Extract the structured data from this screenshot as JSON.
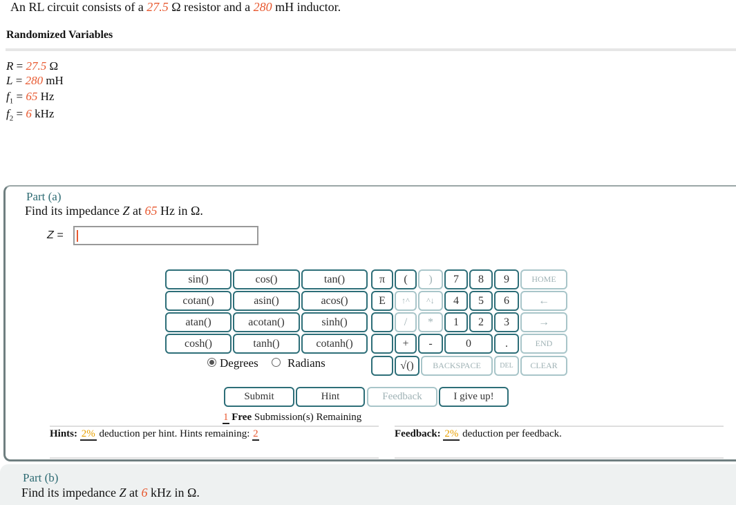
{
  "intro": {
    "prefix": "An RL circuit consists of a ",
    "r_value": "27.5",
    "r_unit": " Ω resistor and a ",
    "l_value": "280",
    "l_unit": " mH inductor."
  },
  "randomized": {
    "title": "Randomized Variables",
    "vars": [
      {
        "sym": "R",
        "sub": "",
        "eq": " = ",
        "value": "27.5",
        "unit": " Ω"
      },
      {
        "sym": "L",
        "sub": "",
        "eq": " = ",
        "value": "280",
        "unit": " mH"
      },
      {
        "sym": "f",
        "sub": "1",
        "eq": " = ",
        "value": "65",
        "unit": " Hz"
      },
      {
        "sym": "f",
        "sub": "2",
        "eq": " = ",
        "value": "6",
        "unit": " kHz"
      }
    ]
  },
  "part_a": {
    "title": "Part (a)",
    "q_prefix": "Find its impedance ",
    "q_var": "Z",
    "q_mid": " at ",
    "q_value": "65",
    "q_suffix": " Hz in Ω.",
    "input_label": "Z = ",
    "input_value": ""
  },
  "keypad": {
    "functions": [
      "sin()",
      "cos()",
      "tan()",
      "cotan()",
      "asin()",
      "acos()",
      "atan()",
      "acotan()",
      "sinh()",
      "cosh()",
      "tanh()",
      "cotanh()"
    ],
    "pi": "π",
    "lparen": "(",
    "rparen": ")",
    "e": "E",
    "up_up": "↑^",
    "up_down": "^↓",
    "div": "/",
    "mul": "*",
    "plus": "+",
    "minus": "-",
    "sqrt": "√()",
    "digits": [
      "7",
      "8",
      "9",
      "4",
      "5",
      "6",
      "1",
      "2",
      "3",
      "0",
      "."
    ],
    "home": "HOME",
    "left": "←",
    "right": "→",
    "end": "END",
    "backspace": "BACKSPACE",
    "del": "DEL",
    "clear": "CLEAR",
    "degrees": "Degrees",
    "radians": "Radians"
  },
  "actions": {
    "submit": "Submit",
    "hint": "Hint",
    "feedback": "Feedback",
    "give_up": "I give up!"
  },
  "submissions": {
    "count": "1",
    "bold": "Free",
    "text": " Submission(s) Remaining"
  },
  "hints": {
    "label": "Hints:",
    "pct": "2%",
    "text": " deduction per hint. Hints remaining: ",
    "remaining": "2"
  },
  "feedback": {
    "label": "Feedback:",
    "pct": "2%",
    "text": " deduction per feedback."
  },
  "part_b": {
    "title": "Part (b)",
    "q_prefix": "Find its impedance ",
    "q_var": "Z",
    "q_mid": " at ",
    "q_value": "6",
    "q_suffix": " kHz in Ω."
  },
  "colors": {
    "accent": "#e8582f",
    "teal": "#2d6e78",
    "pct": "#e8a000"
  }
}
